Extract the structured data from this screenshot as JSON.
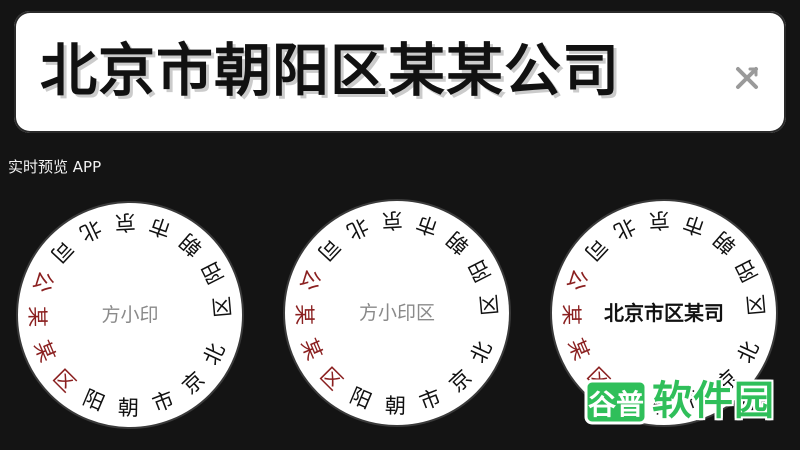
{
  "input": {
    "value": "北京市朝阳区某某公司"
  },
  "section": {
    "label": "实时预览 APP"
  },
  "stamps": [
    {
      "ring_text": "北京市朝阳区某某公司北京市朝阳区",
      "center_text": "方小印",
      "ring_color": "#111111",
      "accent_color": "#8a1f1f"
    },
    {
      "ring_text": "北京市朝阳区某某公司北京市朝阳区",
      "center_text": "方小印区",
      "ring_color": "#111111",
      "accent_color": "#8a1f1f"
    },
    {
      "ring_text": "北京市朝阳区某某公司北京市朝阳区",
      "center_text": "北京市区某司",
      "ring_color": "#111111",
      "accent_color": "#8a1f1f"
    }
  ],
  "watermark": {
    "logo_text": "谷普",
    "text": "软件园",
    "color": "#2fbf5a"
  },
  "icons": {
    "clear": "close-icon"
  }
}
